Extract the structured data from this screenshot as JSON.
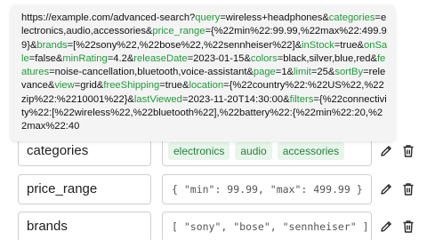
{
  "url_tooltip": {
    "segments": [
      {
        "t": "https://example.com/advanced-search?",
        "k": false
      },
      {
        "t": "query",
        "k": true
      },
      {
        "t": "=wireless+headphones&",
        "k": false
      },
      {
        "t": "categories",
        "k": true
      },
      {
        "t": "=electronics,audio,accessories&",
        "k": false
      },
      {
        "t": "price_range",
        "k": true
      },
      {
        "t": "={%22min%22:99.99,%22max%22:499.99}&",
        "k": false
      },
      {
        "t": "brands",
        "k": true
      },
      {
        "t": "=[%22sony%22,%22bose%22,%22sennheiser%22]&",
        "k": false
      },
      {
        "t": "inStock",
        "k": true
      },
      {
        "t": "=true&",
        "k": false
      },
      {
        "t": "onSale",
        "k": true
      },
      {
        "t": "=false&",
        "k": false
      },
      {
        "t": "minRating",
        "k": true
      },
      {
        "t": "=4.2&",
        "k": false
      },
      {
        "t": "releaseDate",
        "k": true
      },
      {
        "t": "=2023-01-15&",
        "k": false
      },
      {
        "t": "colors",
        "k": true
      },
      {
        "t": "=black,silver,blue,red&",
        "k": false
      },
      {
        "t": "features",
        "k": true
      },
      {
        "t": "=noise-cancellation,bluetooth,voice-assistant&",
        "k": false
      },
      {
        "t": "page",
        "k": true
      },
      {
        "t": "=1&",
        "k": false
      },
      {
        "t": "limit",
        "k": true
      },
      {
        "t": "=25&",
        "k": false
      },
      {
        "t": "sortBy",
        "k": true
      },
      {
        "t": "=relevance&",
        "k": false
      },
      {
        "t": "view",
        "k": true
      },
      {
        "t": "=grid&",
        "k": false
      },
      {
        "t": "freeShipping",
        "k": true
      },
      {
        "t": "=true&",
        "k": false
      },
      {
        "t": "location",
        "k": true
      },
      {
        "t": "={%22country%22:%22US%22,%22zip%22:%2210001%22}&",
        "k": false
      },
      {
        "t": "lastViewed",
        "k": true
      },
      {
        "t": "=2023-11-20T14:30:00&",
        "k": false
      },
      {
        "t": "filters",
        "k": true
      },
      {
        "t": "={%22connectivity%22:[%22wireless%22,%22bluetooth%22],%22battery%22:{%22min%22:20,%22max%22:40",
        "k": false
      }
    ]
  },
  "params": {
    "categories": {
      "name": "categories",
      "chips": [
        "electronics",
        "audio",
        "accessories"
      ]
    },
    "price_range": {
      "name": "price_range",
      "value": "{ \"min\": 99.99, \"max\": 499.99 }"
    },
    "brands": {
      "name": "brands",
      "value": "[ \"sony\", \"bose\", \"sennheiser\" ]"
    }
  },
  "colors": {
    "param_key": "#1f9a3a",
    "chip_bg": "#e7f5ea",
    "chip_text": "#26803c",
    "border": "#cfcfcf"
  },
  "icons": {
    "edit": "pencil-icon",
    "delete": "trash-icon"
  }
}
